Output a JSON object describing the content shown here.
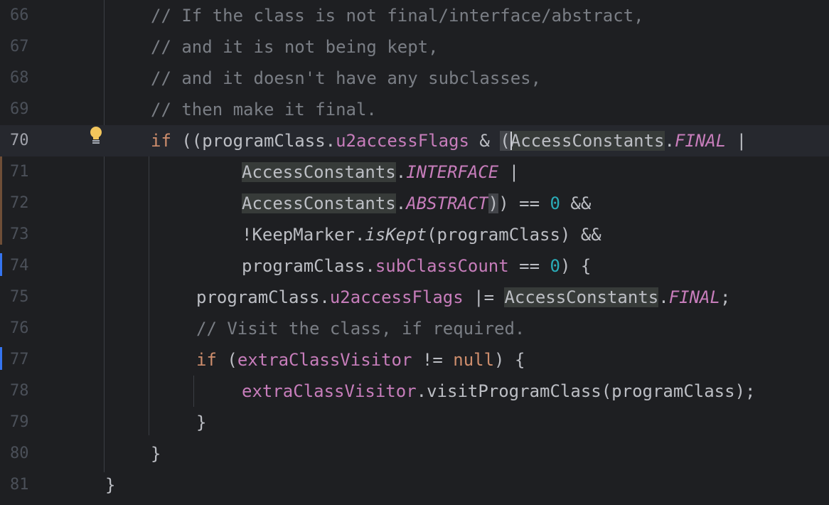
{
  "editor": {
    "current_line": "70",
    "lines": [
      {
        "n": "66",
        "t": "// If the class is not final/interface/abstract,"
      },
      {
        "n": "67",
        "t": "// and it is not being kept,"
      },
      {
        "n": "68",
        "t": "// and it doesn't have any subclasses,"
      },
      {
        "n": "69",
        "t": "// then make it final."
      },
      {
        "n": "70",
        "a": "if",
        "b": " ((programClass.",
        "c": "u2accessFlags",
        "d": " & ",
        "e": "(",
        "f": "AccessConstants",
        "g": ".",
        "h": "FINAL",
        "i": " |"
      },
      {
        "n": "71",
        "a": "AccessConstants",
        "b": ".",
        "c": "INTERFACE",
        "d": " |"
      },
      {
        "n": "72",
        "a": "AccessConstants",
        "b": ".",
        "c": "ABSTRACT",
        "d": ")",
        "e": ") == ",
        "f": "0",
        "g": " &&"
      },
      {
        "n": "73",
        "a": "!KeepMarker.",
        "b": "isKept",
        "c": "(programClass) &&"
      },
      {
        "n": "74",
        "a": "programClass.",
        "b": "subClassCount",
        "c": " == ",
        "d": "0",
        "e": ") {"
      },
      {
        "n": "75",
        "a": "programClass.",
        "b": "u2accessFlags",
        "c": " |= ",
        "d": "AccessConstants",
        "e": ".",
        "f": "FINAL",
        "g": ";"
      },
      {
        "n": "76",
        "t": "// Visit the class, if required."
      },
      {
        "n": "77",
        "a": "if",
        "b": " (",
        "c": "extraClassVisitor",
        "d": " != ",
        "e": "null",
        "f": ") {"
      },
      {
        "n": "78",
        "a": "extraClassVisitor",
        "b": ".visitProgramClass(programClass);"
      },
      {
        "n": "79",
        "t": "}"
      },
      {
        "n": "80",
        "t": "}"
      },
      {
        "n": "81",
        "t": "}"
      }
    ]
  },
  "gutter": {
    "intention_icon": "lightbulb-icon",
    "intention_color": "#f2c55c",
    "change_marker_color": "#3574f0",
    "fold_marker_color": "#6f4e37"
  }
}
